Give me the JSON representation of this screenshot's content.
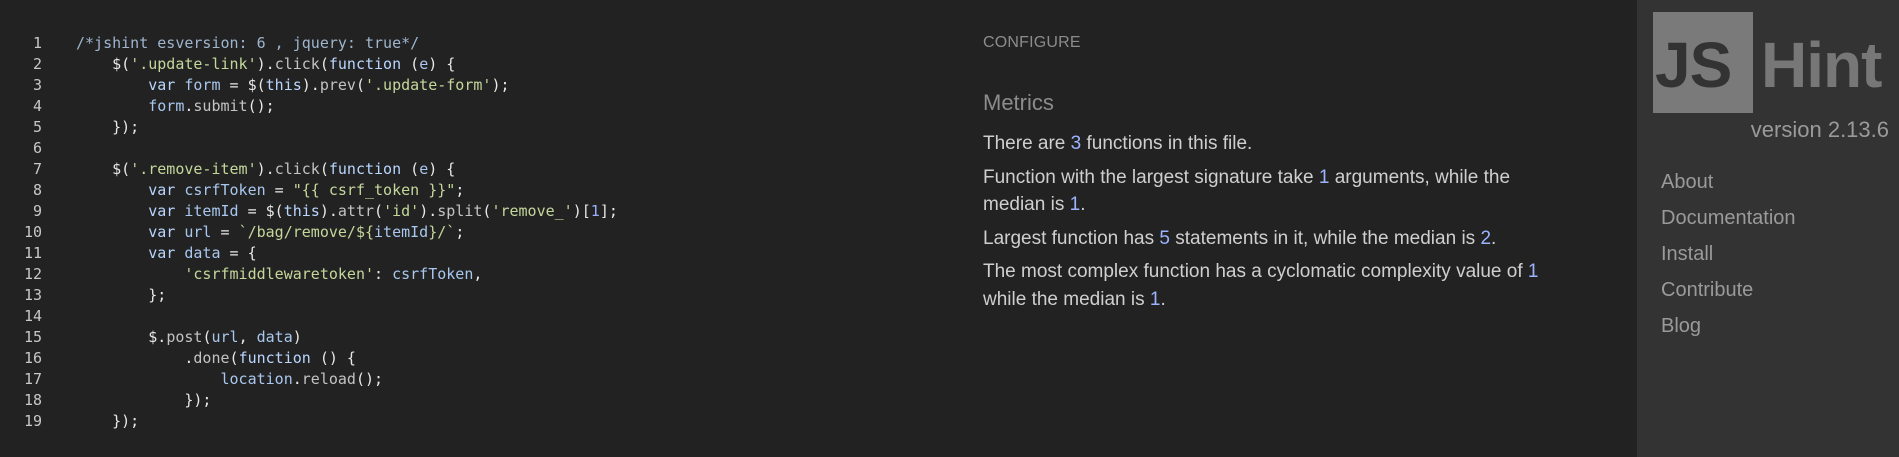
{
  "editor": {
    "lines": [
      {
        "n": "1",
        "tokens": [
          [
            "t-cm",
            "/*jshint esversion: 6 , jquery: true*/"
          ]
        ]
      },
      {
        "n": "2",
        "tokens": [
          [
            "t-plain",
            "    $("
          ],
          [
            "t-str",
            "'.update-link'"
          ],
          [
            "t-plain",
            ")."
          ],
          [
            "t-fn",
            "click"
          ],
          [
            "t-plain",
            "("
          ],
          [
            "t-kw",
            "function"
          ],
          [
            "t-plain",
            " ("
          ],
          [
            "t-var",
            "e"
          ],
          [
            "t-plain",
            ") {"
          ]
        ]
      },
      {
        "n": "3",
        "tokens": [
          [
            "t-plain",
            "        "
          ],
          [
            "t-kw",
            "var"
          ],
          [
            "t-plain",
            " "
          ],
          [
            "t-var",
            "form"
          ],
          [
            "t-plain",
            " = $("
          ],
          [
            "t-kw",
            "this"
          ],
          [
            "t-plain",
            ")."
          ],
          [
            "t-fn",
            "prev"
          ],
          [
            "t-plain",
            "("
          ],
          [
            "t-str",
            "'.update-form'"
          ],
          [
            "t-plain",
            ");"
          ]
        ]
      },
      {
        "n": "4",
        "tokens": [
          [
            "t-plain",
            "        "
          ],
          [
            "t-var",
            "form"
          ],
          [
            "t-plain",
            "."
          ],
          [
            "t-fn",
            "submit"
          ],
          [
            "t-plain",
            "();"
          ]
        ]
      },
      {
        "n": "5",
        "tokens": [
          [
            "t-plain",
            "    });"
          ]
        ]
      },
      {
        "n": "6",
        "tokens": [
          [
            "t-plain",
            ""
          ]
        ]
      },
      {
        "n": "7",
        "tokens": [
          [
            "t-plain",
            "    $("
          ],
          [
            "t-str",
            "'.remove-item'"
          ],
          [
            "t-plain",
            ")."
          ],
          [
            "t-fn",
            "click"
          ],
          [
            "t-plain",
            "("
          ],
          [
            "t-kw",
            "function"
          ],
          [
            "t-plain",
            " ("
          ],
          [
            "t-var",
            "e"
          ],
          [
            "t-plain",
            ") {"
          ]
        ]
      },
      {
        "n": "8",
        "tokens": [
          [
            "t-plain",
            "        "
          ],
          [
            "t-kw",
            "var"
          ],
          [
            "t-plain",
            " "
          ],
          [
            "t-var",
            "csrfToken"
          ],
          [
            "t-plain",
            " = "
          ],
          [
            "t-str",
            "\"{{ csrf_token }}\""
          ],
          [
            "t-plain",
            ";"
          ]
        ]
      },
      {
        "n": "9",
        "tokens": [
          [
            "t-plain",
            "        "
          ],
          [
            "t-kw",
            "var"
          ],
          [
            "t-plain",
            " "
          ],
          [
            "t-var",
            "itemId"
          ],
          [
            "t-plain",
            " = $("
          ],
          [
            "t-kw",
            "this"
          ],
          [
            "t-plain",
            ")."
          ],
          [
            "t-fn",
            "attr"
          ],
          [
            "t-plain",
            "("
          ],
          [
            "t-str",
            "'id'"
          ],
          [
            "t-plain",
            ")."
          ],
          [
            "t-fn",
            "split"
          ],
          [
            "t-plain",
            "("
          ],
          [
            "t-str",
            "'remove_'"
          ],
          [
            "t-plain",
            ")["
          ],
          [
            "t-num",
            "1"
          ],
          [
            "t-plain",
            "];"
          ]
        ]
      },
      {
        "n": "10",
        "tokens": [
          [
            "t-plain",
            "        "
          ],
          [
            "t-kw",
            "var"
          ],
          [
            "t-plain",
            " "
          ],
          [
            "t-var",
            "url"
          ],
          [
            "t-plain",
            " = "
          ],
          [
            "t-str",
            "`/bag/remove/${"
          ],
          [
            "t-var",
            "itemId"
          ],
          [
            "t-str",
            "}/`"
          ],
          [
            "t-plain",
            ";"
          ]
        ]
      },
      {
        "n": "11",
        "tokens": [
          [
            "t-plain",
            "        "
          ],
          [
            "t-kw",
            "var"
          ],
          [
            "t-plain",
            " "
          ],
          [
            "t-var",
            "data"
          ],
          [
            "t-plain",
            " = {"
          ]
        ]
      },
      {
        "n": "12",
        "tokens": [
          [
            "t-plain",
            "            "
          ],
          [
            "t-str",
            "'csrfmiddlewaretoken'"
          ],
          [
            "t-plain",
            ": "
          ],
          [
            "t-var",
            "csrfToken"
          ],
          [
            "t-plain",
            ","
          ]
        ]
      },
      {
        "n": "13",
        "tokens": [
          [
            "t-plain",
            "        };"
          ]
        ]
      },
      {
        "n": "14",
        "tokens": [
          [
            "t-plain",
            ""
          ]
        ]
      },
      {
        "n": "15",
        "tokens": [
          [
            "t-plain",
            "        $."
          ],
          [
            "t-fn",
            "post"
          ],
          [
            "t-plain",
            "("
          ],
          [
            "t-var",
            "url"
          ],
          [
            "t-plain",
            ", "
          ],
          [
            "t-var",
            "data"
          ],
          [
            "t-plain",
            ")"
          ]
        ]
      },
      {
        "n": "16",
        "tokens": [
          [
            "t-plain",
            "            ."
          ],
          [
            "t-fn",
            "done"
          ],
          [
            "t-plain",
            "("
          ],
          [
            "t-kw",
            "function"
          ],
          [
            "t-plain",
            " () {"
          ]
        ]
      },
      {
        "n": "17",
        "tokens": [
          [
            "t-plain",
            "                "
          ],
          [
            "t-var",
            "location"
          ],
          [
            "t-plain",
            "."
          ],
          [
            "t-fn",
            "reload"
          ],
          [
            "t-plain",
            "();"
          ]
        ]
      },
      {
        "n": "18",
        "tokens": [
          [
            "t-plain",
            "            });"
          ]
        ]
      },
      {
        "n": "19",
        "tokens": [
          [
            "t-plain",
            "    });"
          ]
        ]
      }
    ]
  },
  "report": {
    "configure_label": "CONFIGURE",
    "metrics_title": "Metrics",
    "metrics": [
      [
        [
          "",
          "There are "
        ],
        [
          "hl",
          "3"
        ],
        [
          "",
          " functions in this file."
        ]
      ],
      [
        [
          "",
          "Function with the largest signature take "
        ],
        [
          "hl",
          "1"
        ],
        [
          "",
          " arguments, while the median is "
        ],
        [
          "hl",
          "1"
        ],
        [
          "",
          "."
        ]
      ],
      [
        [
          "",
          "Largest function has "
        ],
        [
          "hl",
          "5"
        ],
        [
          "",
          " statements in it, while the median is "
        ],
        [
          "hl",
          "2"
        ],
        [
          "",
          "."
        ]
      ],
      [
        [
          "",
          "The most complex function has a cyclomatic complexity value of "
        ],
        [
          "hl",
          "1"
        ],
        [
          "",
          " while the median is "
        ],
        [
          "hl",
          "1"
        ],
        [
          "",
          "."
        ]
      ]
    ]
  },
  "sidebar": {
    "logo_js": "JS",
    "logo_hint": "Hint",
    "version": "version 2.13.6",
    "nav": [
      "About",
      "Documentation",
      "Install",
      "Contribute",
      "Blog"
    ]
  },
  "colors": {
    "background": "#222222",
    "sidebar": "#333333",
    "highlight_number": "#9cb3ff"
  }
}
